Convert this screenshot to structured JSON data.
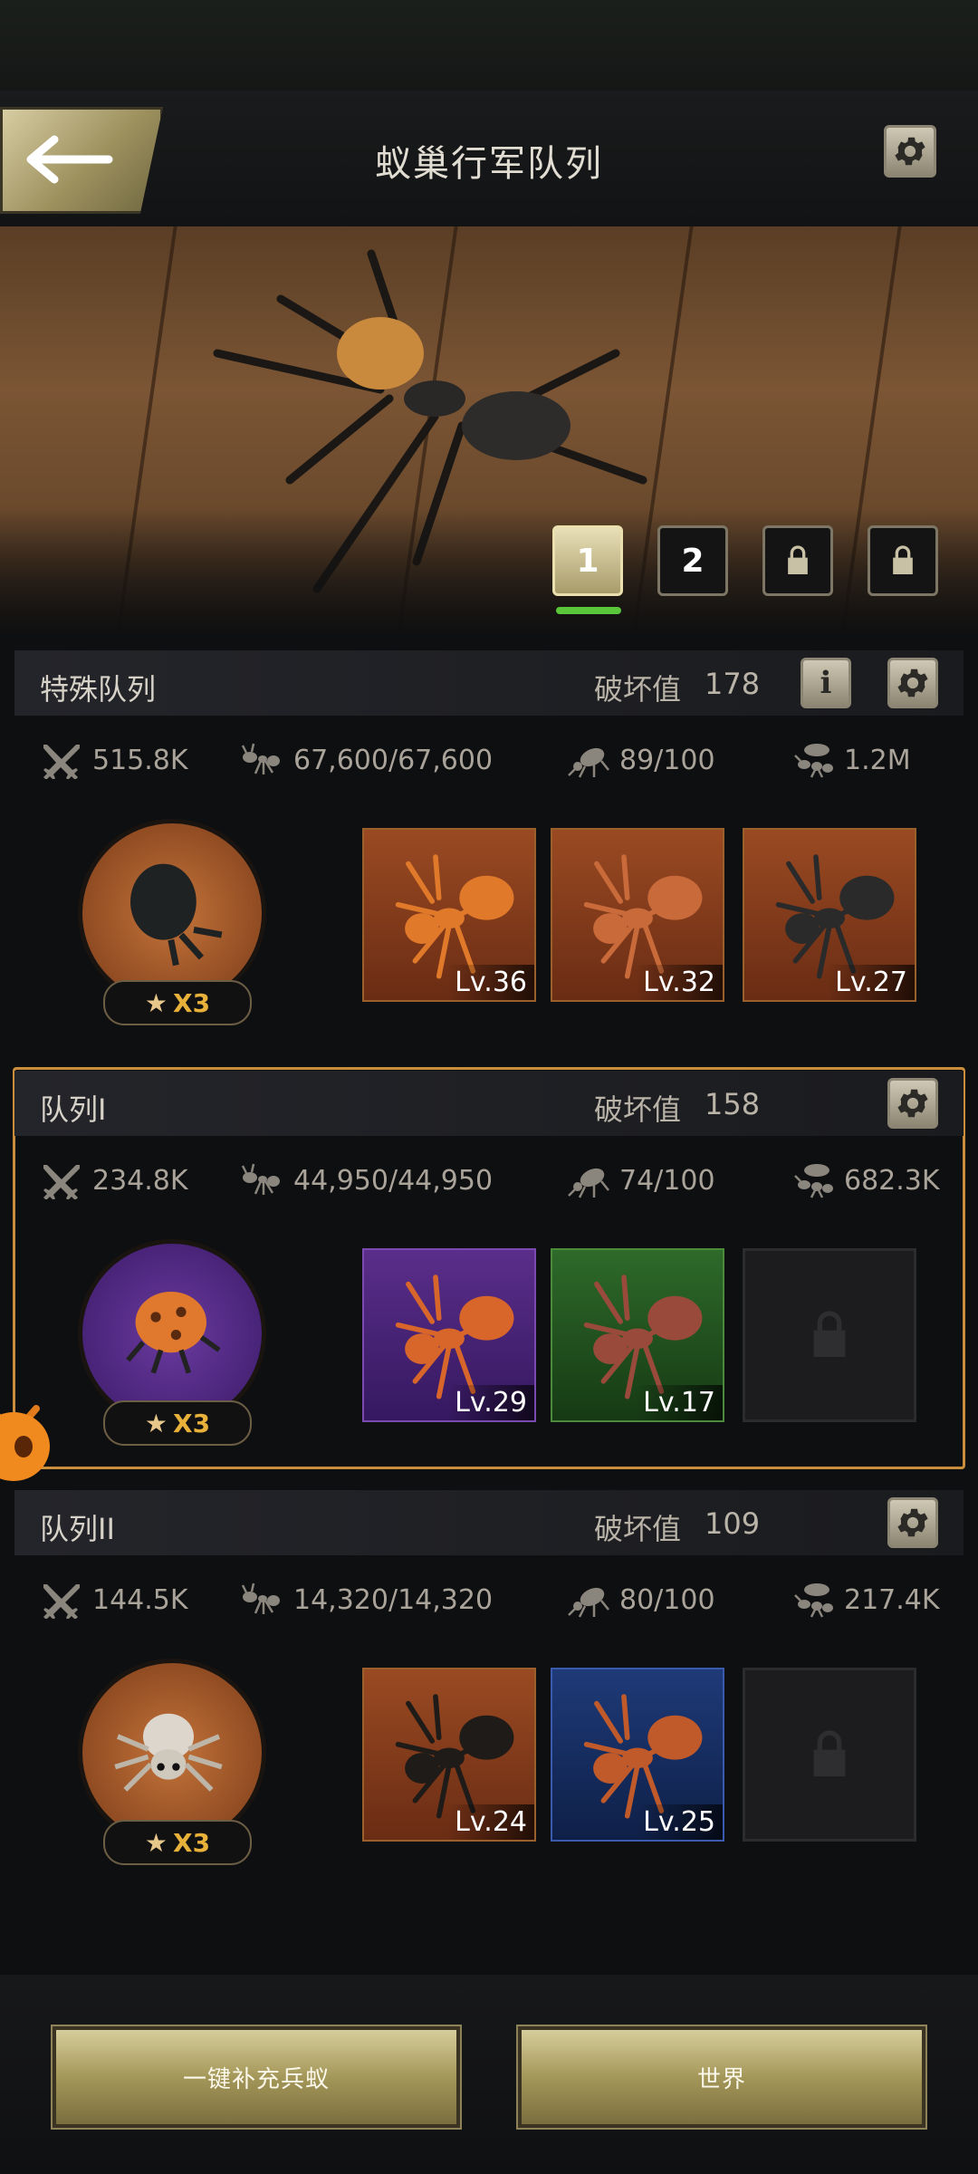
{
  "header": {
    "title": "蚁巢行军队列"
  },
  "team_tabs": [
    "1",
    "2"
  ],
  "sections": [
    {
      "title": "特殊队列",
      "power_label": "破坏值",
      "power_value": "178",
      "stats": {
        "attack": "515.8K",
        "troops": "67,600/67,600",
        "capacity": "89/100",
        "load": "1.2M"
      },
      "leader_badge": "X3",
      "ants": [
        {
          "level": "Lv.36"
        },
        {
          "level": "Lv.32"
        },
        {
          "level": "Lv.27"
        }
      ]
    },
    {
      "title": "队列I",
      "power_label": "破坏值",
      "power_value": "158",
      "stats": {
        "attack": "234.8K",
        "troops": "44,950/44,950",
        "capacity": "74/100",
        "load": "682.3K"
      },
      "leader_badge": "X3",
      "ants": [
        {
          "level": "Lv.29"
        },
        {
          "level": "Lv.17"
        }
      ]
    },
    {
      "title": "队列II",
      "power_label": "破坏值",
      "power_value": "109",
      "stats": {
        "attack": "144.5K",
        "troops": "14,320/14,320",
        "capacity": "80/100",
        "load": "217.4K"
      },
      "leader_badge": "X3",
      "ants": [
        {
          "level": "Lv.24"
        },
        {
          "level": "Lv.25"
        }
      ]
    }
  ],
  "bottom": {
    "refill_button": "一键补充兵蚁",
    "world_button": "世界"
  },
  "icons": {
    "back": "arrow-left-icon",
    "settings": "gear-icon",
    "info": "info-icon",
    "lock": "lock-icon",
    "attack": "crossed-swords-icon",
    "troops": "ant-icon",
    "capacity": "bug-icon",
    "load": "carrier-ant-icon",
    "star": "star-icon"
  },
  "colors": {
    "gold_button": "#a49759",
    "selected_border": "#c98d3c",
    "active_tab_indicator": "#5ac63a",
    "badge_text": "#e8b13a"
  }
}
